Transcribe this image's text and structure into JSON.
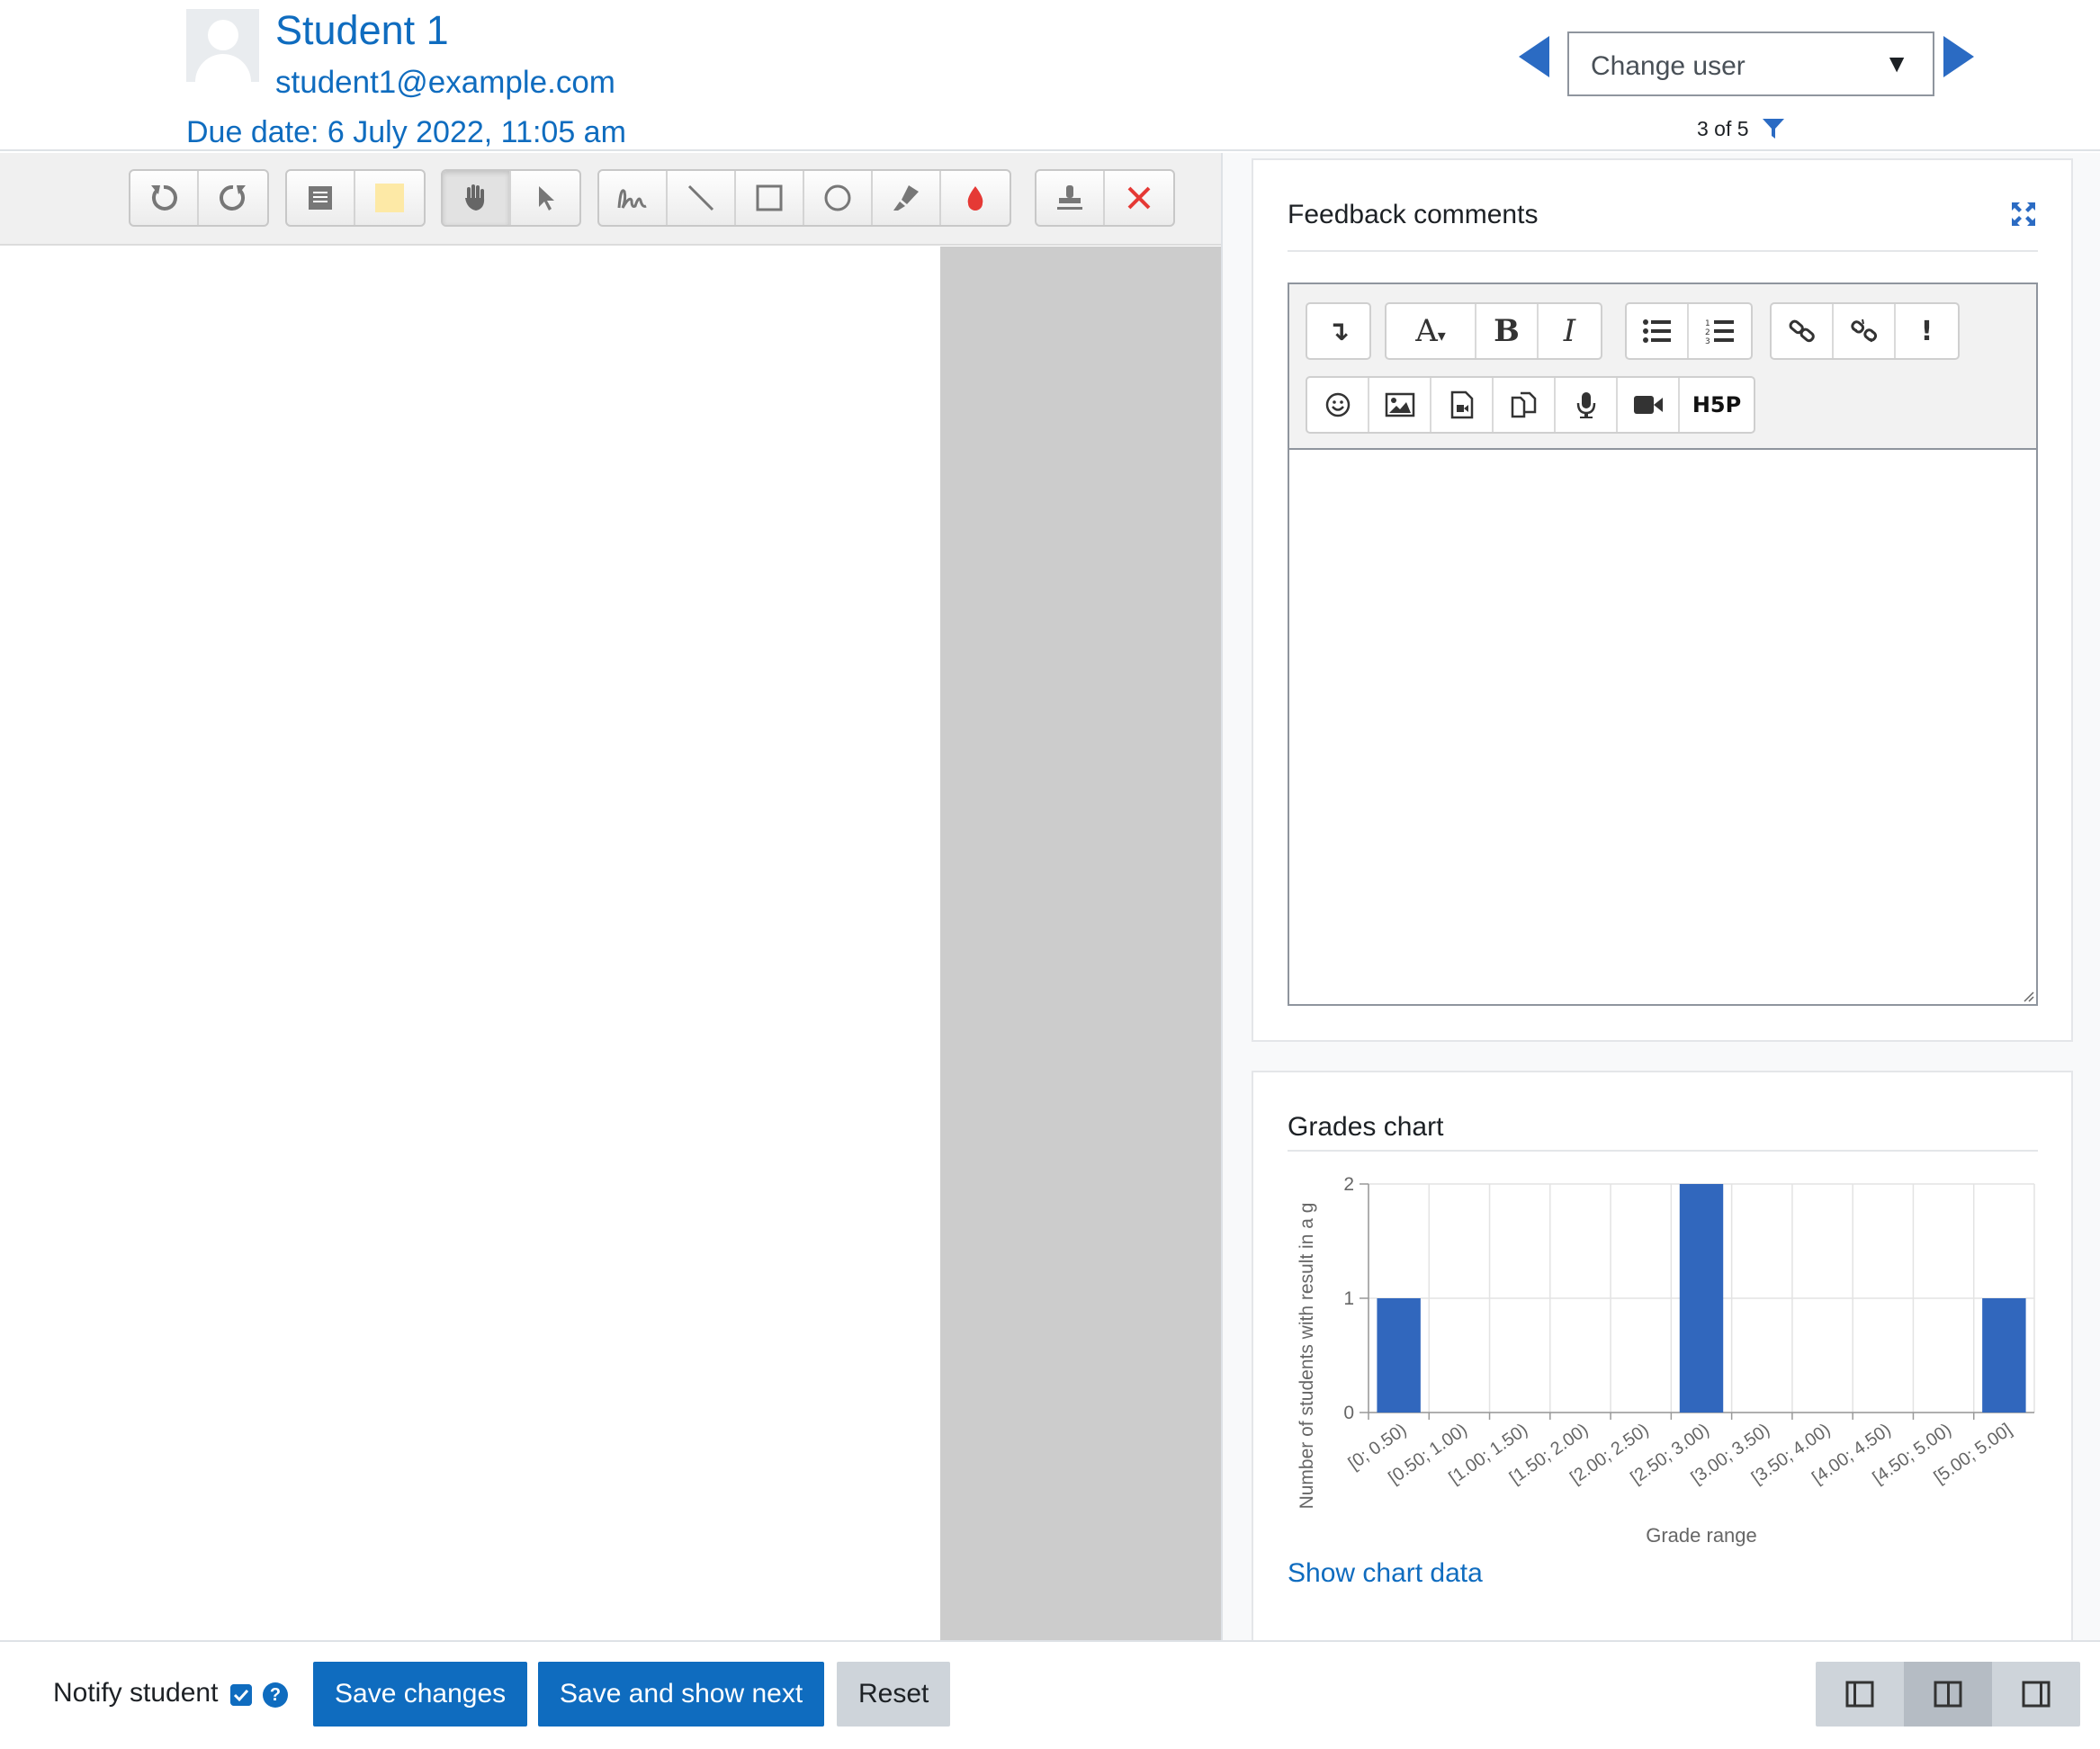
{
  "header": {
    "student_name": "Student 1",
    "student_email": "student1@example.com",
    "due_date": "Due date: 6 July 2022, 11:05 am",
    "change_user_placeholder": "Change user",
    "count": "3 of 5"
  },
  "annotation_toolbar": {
    "groups": [
      [
        "rotate-left-icon",
        "rotate-right-icon"
      ],
      [
        "comment-search-icon",
        "comment-color-icon"
      ],
      [
        "pan-icon",
        "select-icon"
      ],
      [
        "pen-icon",
        "line-icon",
        "rectangle-icon",
        "oval-icon",
        "highlight-icon",
        "annotation-color-icon"
      ],
      [
        "stamp-icon",
        "stamp-delete-icon"
      ]
    ],
    "active_tool": "pan-icon"
  },
  "feedback": {
    "title": "Feedback comments",
    "editor_toolbar_row1": [
      "show-more-icon",
      "paragraph-styles-icon",
      "bold-icon",
      "italic-icon",
      "unordered-list-icon",
      "ordered-list-icon",
      "link-icon",
      "unlink-icon",
      "accessibility-checker-icon"
    ],
    "editor_toolbar_row2": [
      "emoji-icon",
      "image-icon",
      "media-icon",
      "manage-files-icon",
      "record-audio-icon",
      "record-video-icon",
      "h5p-icon"
    ],
    "body": ""
  },
  "grades": {
    "title": "Grades chart",
    "show_chart_data": "Show chart data"
  },
  "chart_data": {
    "type": "bar",
    "categories": [
      "[0; 0.50)",
      "[0.50; 1.00)",
      "[1.00; 1.50)",
      "[1.50; 2.00)",
      "[2.00; 2.50)",
      "[2.50; 3.00)",
      "[3.00; 3.50)",
      "[3.50; 4.00)",
      "[4.00; 4.50)",
      "[4.50; 5.00)",
      "[5.00; 5.00]"
    ],
    "values": [
      1,
      0,
      0,
      0,
      0,
      2,
      0,
      0,
      0,
      0,
      1
    ],
    "xlabel": "Grade range",
    "ylabel": "Number of students with result in a g",
    "ylim": [
      0,
      2
    ],
    "yticks": [
      0,
      1,
      2
    ],
    "grid": true,
    "bar_color": "#3167bd"
  },
  "footer": {
    "notify_label": "Notify student",
    "notify_checked": true,
    "save_changes": "Save changes",
    "save_and_show_next": "Save and show next",
    "reset": "Reset"
  },
  "colors": {
    "accent": "#0f6cbf",
    "stamp_delete": "#e53935",
    "annotation_color": "#e53935",
    "comment_color": "#fde9a6"
  }
}
